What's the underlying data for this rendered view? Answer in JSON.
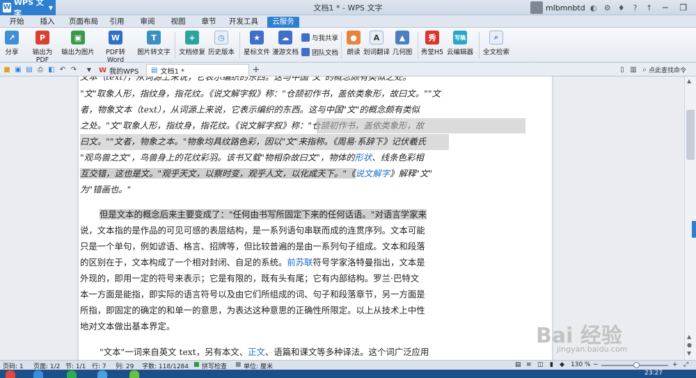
{
  "app": {
    "brand": "WPS 文字",
    "title": "文档1 * - WPS 文字",
    "user": "mlbmnbtd"
  },
  "menu": [
    "开始",
    "插入",
    "页面布局",
    "引用",
    "审阅",
    "视图",
    "章节",
    "开发工具",
    "云服务"
  ],
  "ribbon": {
    "share": "分享",
    "export_pdf": "输出为PDF",
    "export_img": "输出为图片",
    "pdf_word": "PDF转Word",
    "img_text": "图片转文字",
    "repair": "文档修复",
    "history": "历史版本",
    "star": "星标文件",
    "roam": "漫游文档",
    "share_me": "与我共享",
    "team": "团队文档",
    "read": "朗读",
    "translate": "划词翻译",
    "geometry": "几何图",
    "h5": "秀堂H5",
    "cloud_edit": "云编辑器",
    "fulltext": "全文检索"
  },
  "tabs": {
    "mywps": "我的WPS",
    "doc": "文档1 *",
    "search": "点此查找命令"
  },
  "document": {
    "p1_top": "文本（text），从词源上来说，它表示编织的东西。这与中国\"文\"的概念颇有类似之处。",
    "p1_a": "\"文\"取象人形，指纹身，指花纹。《说文解字叙》称：\"仓颉初作书，盖依类象形，故曰文。\"\"文",
    "p1_b": "者，物象文本（text），从词源上来说，它表示编织的东西。这与中国\"文\"的概念颇有类似",
    "p1_c": "之处。\"文\"取象人形，指纹身，指花纹。《说文解字叙》称：\"仓颉初作书，盖依类象形，故",
    "p1_d": "曰文。\"\"文者，物象之本。\"物象均具纹路色彩，因以\"文\"来指称。《周易·系辞下》记伏羲氏",
    "p1_e1": "\"观鸟兽之文\"，鸟兽身上的花纹彩羽。该书又载\"物相杂故曰文\"，物体的",
    "p1_e_link": "形状",
    "p1_e2": "、线条色彩相",
    "p1_f1": "互交错，这也是文。\"观乎天文，以察时变，观乎人文，以化成天下。\"《",
    "p1_f_link": "说文解字",
    "p1_f2": "》解释\"文\"",
    "p1_g": "为\"错画也。\"",
    "p2_a": "但是文本的概念后来主要变成了：\"任何由书写所固定下来的任何话语。\"对语言学家来",
    "p2_b": "说，文本指的是作品的可见可感的表层结构，是一系列语句串联而成的连贯序列。文本可能",
    "p2_c": "只是一个单句，例如谚语、格言、招牌等，但比较普遍的是由一系列句子组成。文本和段落",
    "p2_d1": "的区别在于，文本构成了一个相对封闭、自足的系统。",
    "p2_d_link": "前苏联",
    "p2_d2": "符号学家洛特曼指出，文本是",
    "p2_e": "外现的，即用一定的符号来表示；它是有限的，既有头有尾；它有内部结构。罗兰·巴特文",
    "p2_f": "本一方面是能指，即实际的语言符号以及由它们所组成的词、句子和段落章节，另一方面是",
    "p2_g": "所指，即固定的确定的和单一的意思，为表达这种意思的正确性所限定。以上从技术上中性",
    "p2_h": "地对文本做出基本界定。",
    "p3_a1": "\"文本\"一词来自英文 text，另有本文、",
    "p3_a_link": "正文",
    "p3_a2": "、语篇和课文等多种译法。这个词广泛应用"
  },
  "watermark": {
    "main": "Bai 经验",
    "sub": "jingyan.baidu.com"
  },
  "status": {
    "page_num": "页码: 1",
    "pages": "页面: 1/2",
    "section": "节: 1/1",
    "row": "行: 7",
    "col": "列: 29",
    "words": "字数: 118/1284",
    "spell": "拼写检查",
    "unit": "单位: 厘米",
    "zoom": "130 %"
  },
  "taskbar": {
    "time": "23:27"
  },
  "colors": {
    "accent": "#2f7fd1",
    "link": "#1a6fc9",
    "highlight": "#cfcfcf"
  }
}
